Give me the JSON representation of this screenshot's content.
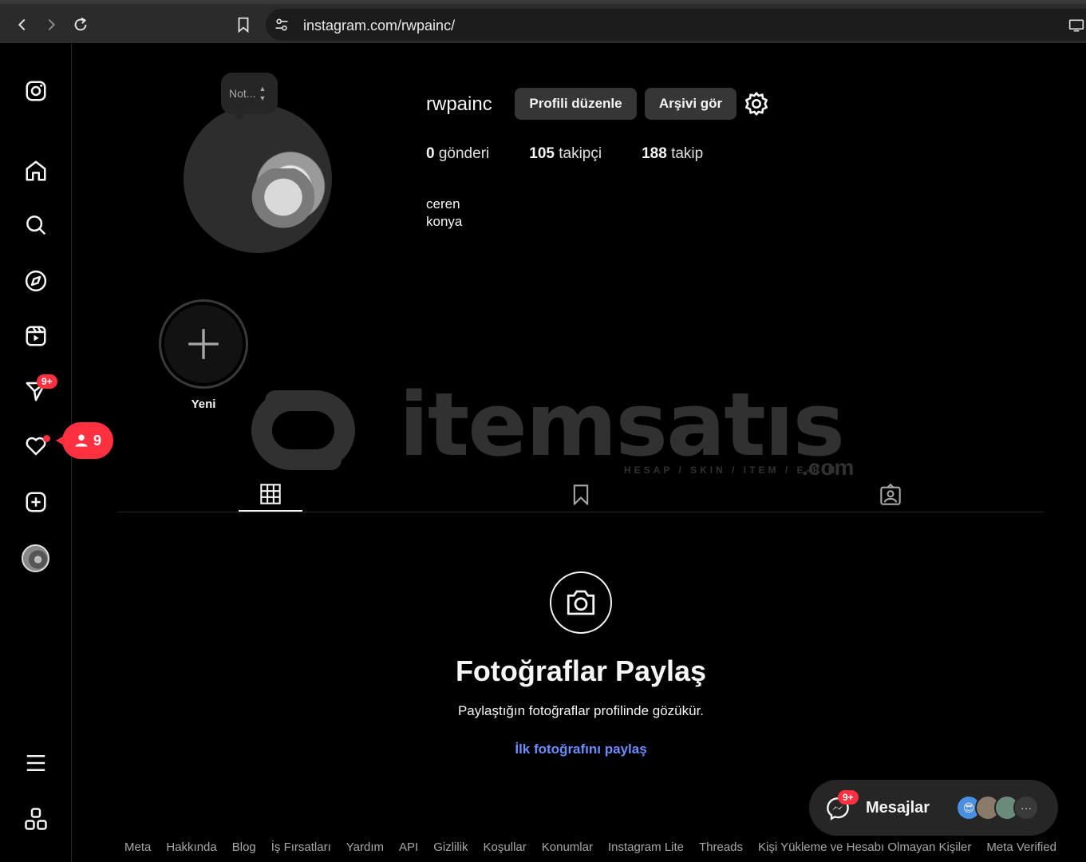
{
  "browser": {
    "url": "instagram.com/rwpainc/"
  },
  "sidebar": {
    "messages_badge": "9+",
    "notifications_count": "9"
  },
  "profile": {
    "note_label": "Not...",
    "username": "rwpainc",
    "edit_button": "Profili düzenle",
    "archive_button": "Arşivi gör",
    "stats": {
      "posts_count": "0",
      "posts_label": "gönderi",
      "followers_count": "105",
      "followers_label": "takipçi",
      "following_count": "188",
      "following_label": "takip"
    },
    "bio_line1": "ceren",
    "bio_line2": "konya"
  },
  "highlights": {
    "new_label": "Yeni"
  },
  "watermark": {
    "brand": "itemsatıs",
    "tagline": "HESAP / SKIN / ITEM / E-PIN",
    "suffix": ".com"
  },
  "empty_state": {
    "title": "Fotoğraflar Paylaş",
    "subtitle": "Paylaştığın fotoğraflar profilinde gözükür.",
    "link": "İlk fotoğrafını paylaş"
  },
  "messages": {
    "label": "Mesajlar",
    "badge": "9+",
    "more": "···"
  },
  "footer": {
    "links": [
      "Meta",
      "Hakkında",
      "Blog",
      "İş Fırsatları",
      "Yardım",
      "API",
      "Gizlilik",
      "Koşullar",
      "Konumlar",
      "Instagram Lite",
      "Threads",
      "Kişi Yükleme ve Hesabı Olmayan Kişiler",
      "Meta Verified"
    ]
  },
  "colors": {
    "background": "#000000",
    "badge": "#ff3040",
    "link": "#6d8cff",
    "button": "#363636"
  }
}
